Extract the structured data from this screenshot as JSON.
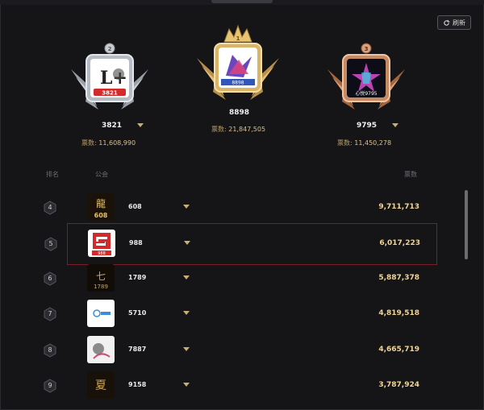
{
  "header": {
    "refresh_label": "刷新"
  },
  "podium": [
    {
      "rank": "2",
      "name": "3821",
      "score_label": "",
      "score": "11,608,990",
      "logo_text": "L+",
      "logo_sub": "3821"
    },
    {
      "rank": "1",
      "name": "8898",
      "score_label": "票数:",
      "score": "21,847,505",
      "logo_text": "",
      "logo_sub": ""
    },
    {
      "rank": "3",
      "name": "9795",
      "score_label": "票数:",
      "score": "11,450,278",
      "logo_text": "",
      "logo_sub": "心悦9795"
    }
  ],
  "podium_score_label_left": "票数:",
  "columns": {
    "rank": "排名",
    "guild": "公会",
    "votes": "票数"
  },
  "rows": [
    {
      "rank": "4",
      "name": "608",
      "score": "9,711,713",
      "avatar_text": "608"
    },
    {
      "rank": "5",
      "name": "988",
      "score": "6,017,223",
      "avatar_text": "988"
    },
    {
      "rank": "6",
      "name": "1789",
      "score": "5,887,378",
      "avatar_text": "1789"
    },
    {
      "rank": "7",
      "name": "5710",
      "score": "4,819,518",
      "avatar_text": ""
    },
    {
      "rank": "8",
      "name": "7887",
      "score": "4,665,719",
      "avatar_text": ""
    },
    {
      "rank": "9",
      "name": "9158",
      "score": "3,787,924",
      "avatar_text": ""
    }
  ],
  "colors": {
    "gold": "#f1d595",
    "highlight_border": "#7a1f28",
    "silver": "#c9cdd3",
    "bronze": "#d9a07a"
  }
}
